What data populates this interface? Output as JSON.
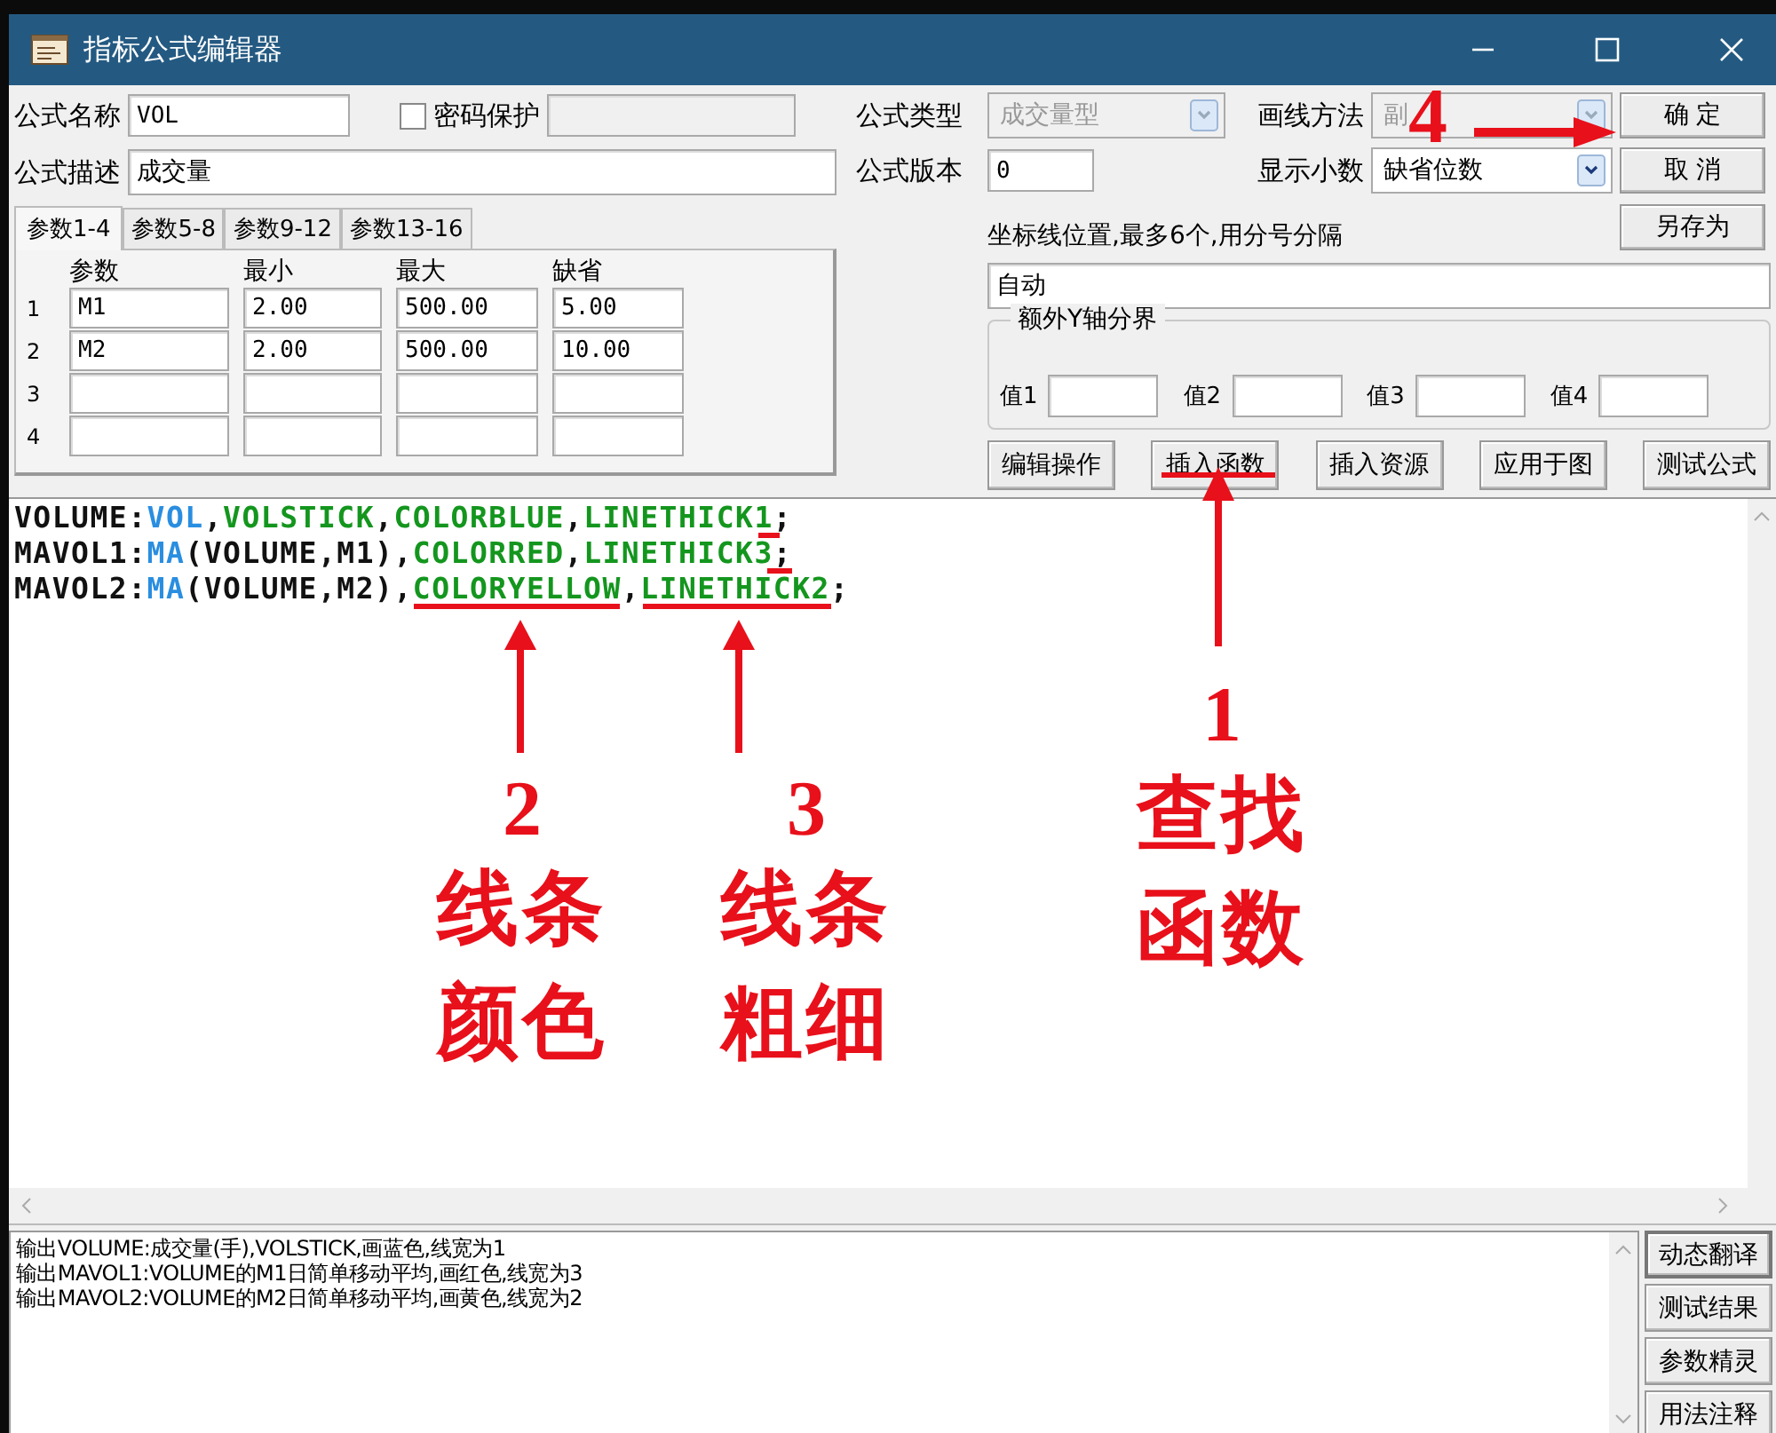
{
  "window": {
    "title": "指标公式编辑器"
  },
  "form": {
    "name": {
      "label": "公式名称",
      "value": "VOL"
    },
    "password": {
      "label": "密码保护",
      "checked": false
    },
    "description": {
      "label": "公式描述",
      "value": "成交量"
    },
    "type": {
      "label": "公式类型",
      "value": "成交量型",
      "disabled": true
    },
    "version": {
      "label": "公式版本",
      "value": "0"
    },
    "draw_method": {
      "label": "画线方法",
      "value": "副",
      "disabled": true
    },
    "decimals": {
      "label": "显示小数",
      "value": "缺省位数",
      "disabled": false
    }
  },
  "side_buttons": [
    "确 定",
    "取 消",
    "另存为"
  ],
  "param_tabs": [
    {
      "label": "参数1-4",
      "selected": true
    },
    {
      "label": "参数5-8",
      "selected": false
    },
    {
      "label": "参数9-12",
      "selected": false
    },
    {
      "label": "参数13-16",
      "selected": false
    }
  ],
  "param_table": {
    "columns": [
      "参数",
      "最小",
      "最大",
      "缺省"
    ],
    "rows": [
      {
        "index": "1",
        "cells": [
          "M1",
          "2.00",
          "500.00",
          "5.00"
        ]
      },
      {
        "index": "2",
        "cells": [
          "M2",
          "2.00",
          "500.00",
          "10.00"
        ]
      },
      {
        "index": "3"
      },
      {
        "index": "4"
      }
    ]
  },
  "axis_lines": {
    "label": "坐标线位置,最多6个,用分号分隔",
    "value": "自动"
  },
  "y_bounds": {
    "title": "额外Y轴分界",
    "fields": [
      "值1",
      "值2",
      "值3",
      "值4"
    ]
  },
  "action_buttons": [
    "编辑操作",
    "插入函数",
    "插入资源",
    "应用于图",
    "测试公式"
  ],
  "code_lines": [
    [
      {
        "text": "VOLUME:",
        "kind": "plain"
      },
      {
        "text": "VOL",
        "kind": "func"
      },
      {
        "text": ",",
        "kind": "plain"
      },
      {
        "text": "VOLSTICK",
        "kind": "keyword"
      },
      {
        "text": ",",
        "kind": "plain"
      },
      {
        "text": "COLORBLUE",
        "kind": "keyword"
      },
      {
        "text": ",",
        "kind": "plain"
      },
      {
        "text": "LINETHICK1",
        "kind": "keyword"
      },
      {
        "text": ";",
        "kind": "plain"
      }
    ],
    [
      {
        "text": "MAVOL1:",
        "kind": "plain"
      },
      {
        "text": "MA",
        "kind": "func"
      },
      {
        "text": "(VOLUME,M1),",
        "kind": "plain"
      },
      {
        "text": "COLORRED",
        "kind": "keyword"
      },
      {
        "text": ",",
        "kind": "plain"
      },
      {
        "text": "LINETHICK3",
        "kind": "keyword"
      },
      {
        "text": ";",
        "kind": "plain"
      }
    ],
    [
      {
        "text": "MAVOL2:",
        "kind": "plain"
      },
      {
        "text": "MA",
        "kind": "func"
      },
      {
        "text": "(VOLUME,M2),",
        "kind": "plain"
      },
      {
        "text": "COLORYELLOW",
        "kind": "keyword"
      },
      {
        "text": ",",
        "kind": "plain"
      },
      {
        "text": "LINETHICK2",
        "kind": "keyword"
      },
      {
        "text": ";",
        "kind": "plain"
      }
    ]
  ],
  "output_lines": [
    "输出VOLUME:成交量(手),VOLSTICK,画蓝色,线宽为1",
    "输出MAVOL1:VOLUME的M1日简单移动平均,画红色,线宽为3",
    "输出MAVOL2:VOLUME的M2日简单移动平均,画黄色,线宽为2"
  ],
  "output_buttons": [
    "动态翻译",
    "测试结果",
    "参数精灵",
    "用法注释"
  ],
  "callouts": [
    {
      "number": "1",
      "words": [
        "查找",
        "函数"
      ]
    },
    {
      "number": "2",
      "words": [
        "线条",
        "颜色"
      ]
    },
    {
      "number": "3",
      "words": [
        "线条",
        "粗细"
      ]
    },
    {
      "number": "4"
    }
  ]
}
